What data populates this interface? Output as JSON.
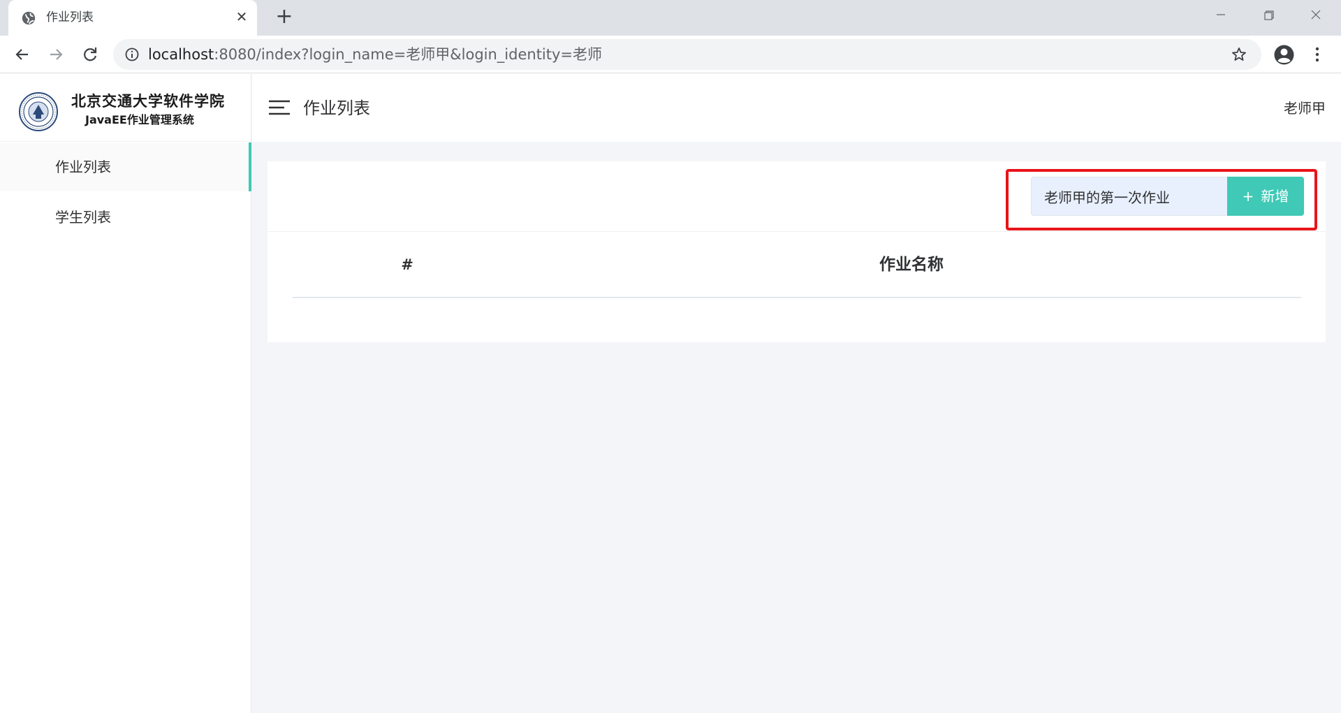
{
  "browser": {
    "tab_title": "作业列表",
    "url_host": "localhost",
    "url_rest": ":8080/index?login_name=老师甲&login_identity=老师"
  },
  "sidebar": {
    "logo_title": "北京交通大学软件学院",
    "logo_subtitle": "JavaEE作业管理系统",
    "items": [
      {
        "label": "作业列表",
        "active": true
      },
      {
        "label": "学生列表",
        "active": false
      }
    ]
  },
  "header": {
    "title": "作业列表",
    "user": "老师甲"
  },
  "form": {
    "homework_name_value": "老师甲的第一次作业",
    "add_label": "新增"
  },
  "table": {
    "columns": [
      "#",
      "作业名称"
    ],
    "rows": []
  },
  "colors": {
    "accent": "#3fc9b6",
    "highlight": "#e8141a",
    "input_bg": "#e8f0fe"
  }
}
